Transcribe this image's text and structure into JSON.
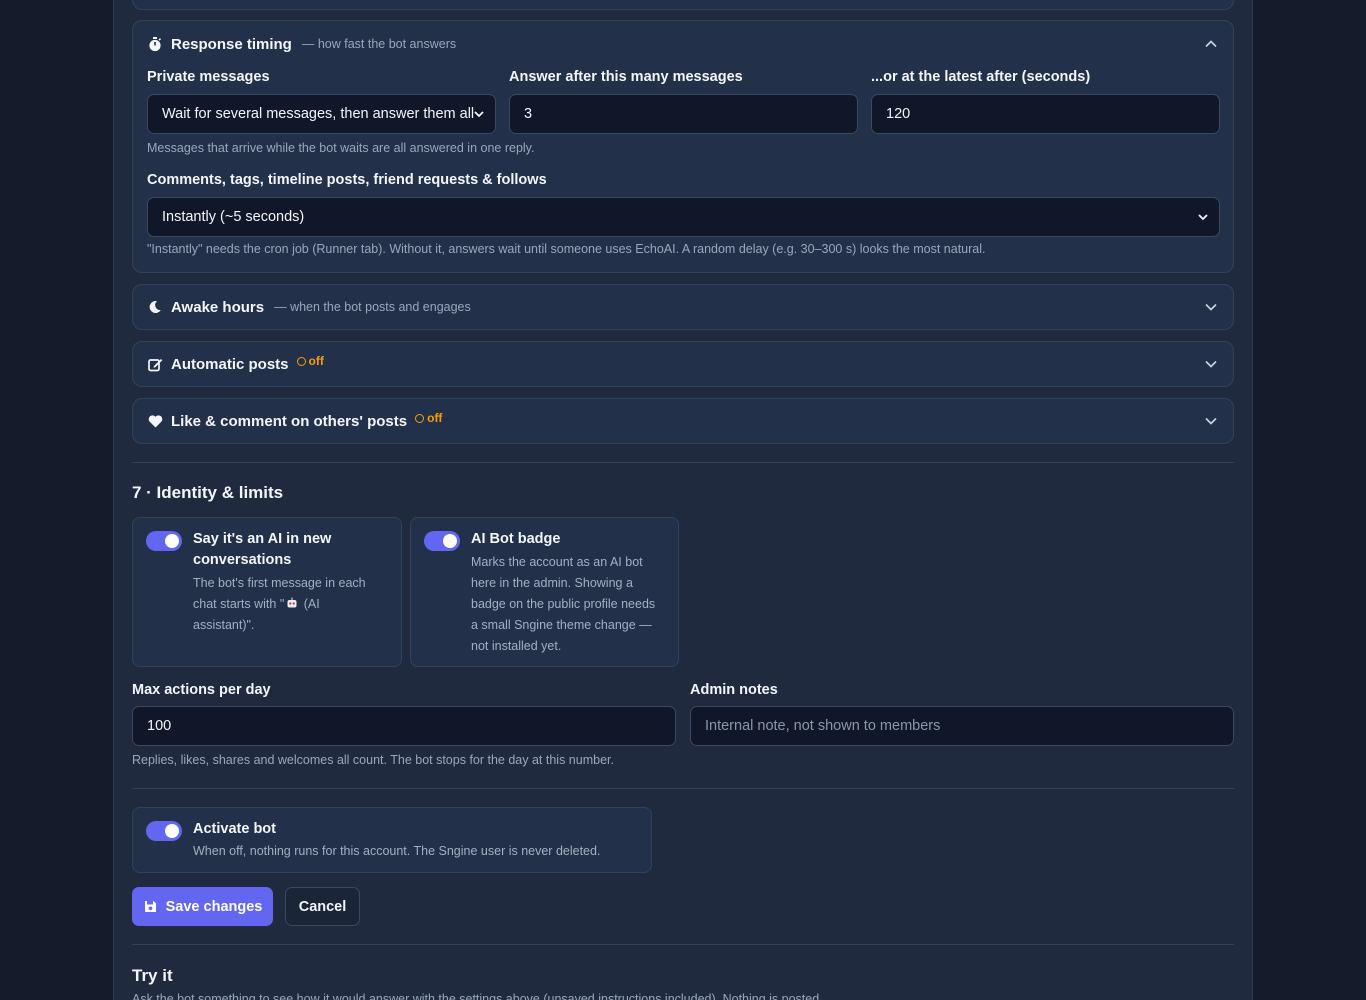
{
  "timing": {
    "title": "Response timing",
    "subtitle": "— how fast the bot answers",
    "private_label": "Private messages",
    "private_value": "Wait for several messages, then answer them all",
    "count_label": "Answer after this many messages",
    "count_value": "3",
    "latest_label": "...or at the latest after (seconds)",
    "latest_value": "120",
    "private_help": "Messages that arrive while the bot waits are all answered in one reply.",
    "public_label": "Comments, tags, timeline posts, friend requests & follows",
    "public_value": "Instantly (~5 seconds)",
    "public_help": "\"Instantly\" needs the cron job (Runner tab). Without it, answers wait until someone uses EchoAI. A random delay (e.g. 30–300 s) looks the most natural."
  },
  "awake": {
    "title": "Awake hours",
    "subtitle": "— when the bot posts and engages"
  },
  "auto_posts": {
    "title": "Automatic posts",
    "badge": "off"
  },
  "like_comment": {
    "title": "Like & comment on others' posts",
    "badge": "off"
  },
  "identity": {
    "heading": "7 · Identity & limits",
    "say_ai": {
      "title_l1": "Say it's an AI in new",
      "title_l2": "conversations",
      "desc_l1": "The bot's first message in each",
      "desc_l2": "chat starts with \"",
      "desc_l2b": " (AI",
      "desc_l3": "assistant)\".",
      "enabled": true
    },
    "badge": {
      "title": "AI Bot badge",
      "desc_l1": "Marks the account as an AI bot",
      "desc_l2": "here in the admin. Showing a",
      "desc_l3": "badge on the public profile needs",
      "desc_l4": "a small Sngine theme change —",
      "desc_l5": "not installed yet.",
      "enabled": true
    },
    "max_label": "Max actions per day",
    "max_value": "100",
    "notes_label": "Admin notes",
    "notes_placeholder": "Internal note, not shown to members",
    "max_help": "Replies, likes, shares and welcomes all count. The bot stops for the day at this number."
  },
  "activate": {
    "title": "Activate bot",
    "desc": "When off, nothing runs for this account. The Sngine user is never deleted.",
    "enabled": true
  },
  "actions": {
    "save": "Save changes",
    "cancel": "Cancel"
  },
  "try": {
    "heading": "Try it",
    "desc": "Ask the bot something to see how it would answer with the settings above (unsaved instructions included). Nothing is posted."
  },
  "colors": {
    "accent": "#6366f1",
    "warning": "#f59e0b",
    "panel": "#1f2a3f",
    "background": "#141c2c"
  }
}
